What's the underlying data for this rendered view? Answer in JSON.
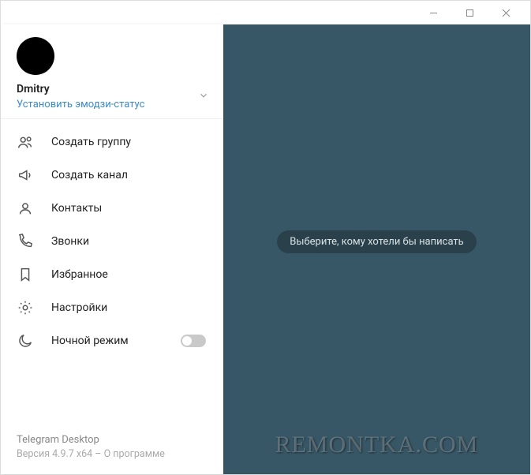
{
  "profile": {
    "name": "Dmitry",
    "emoji_status_link": "Установить эмодзи-статус"
  },
  "menu": {
    "create_group": "Создать группу",
    "create_channel": "Создать канал",
    "contacts": "Контакты",
    "calls": "Звонки",
    "saved": "Избранное",
    "settings": "Настройки",
    "night_mode": "Ночной режим"
  },
  "footer": {
    "appname": "Telegram Desktop",
    "version_prefix": "Версия 4.9.7 x64",
    "sep": " – ",
    "about": "О программе"
  },
  "main": {
    "placeholder": "Выберите, кому хотели бы написать"
  },
  "watermark": "REMONTKA.COM"
}
